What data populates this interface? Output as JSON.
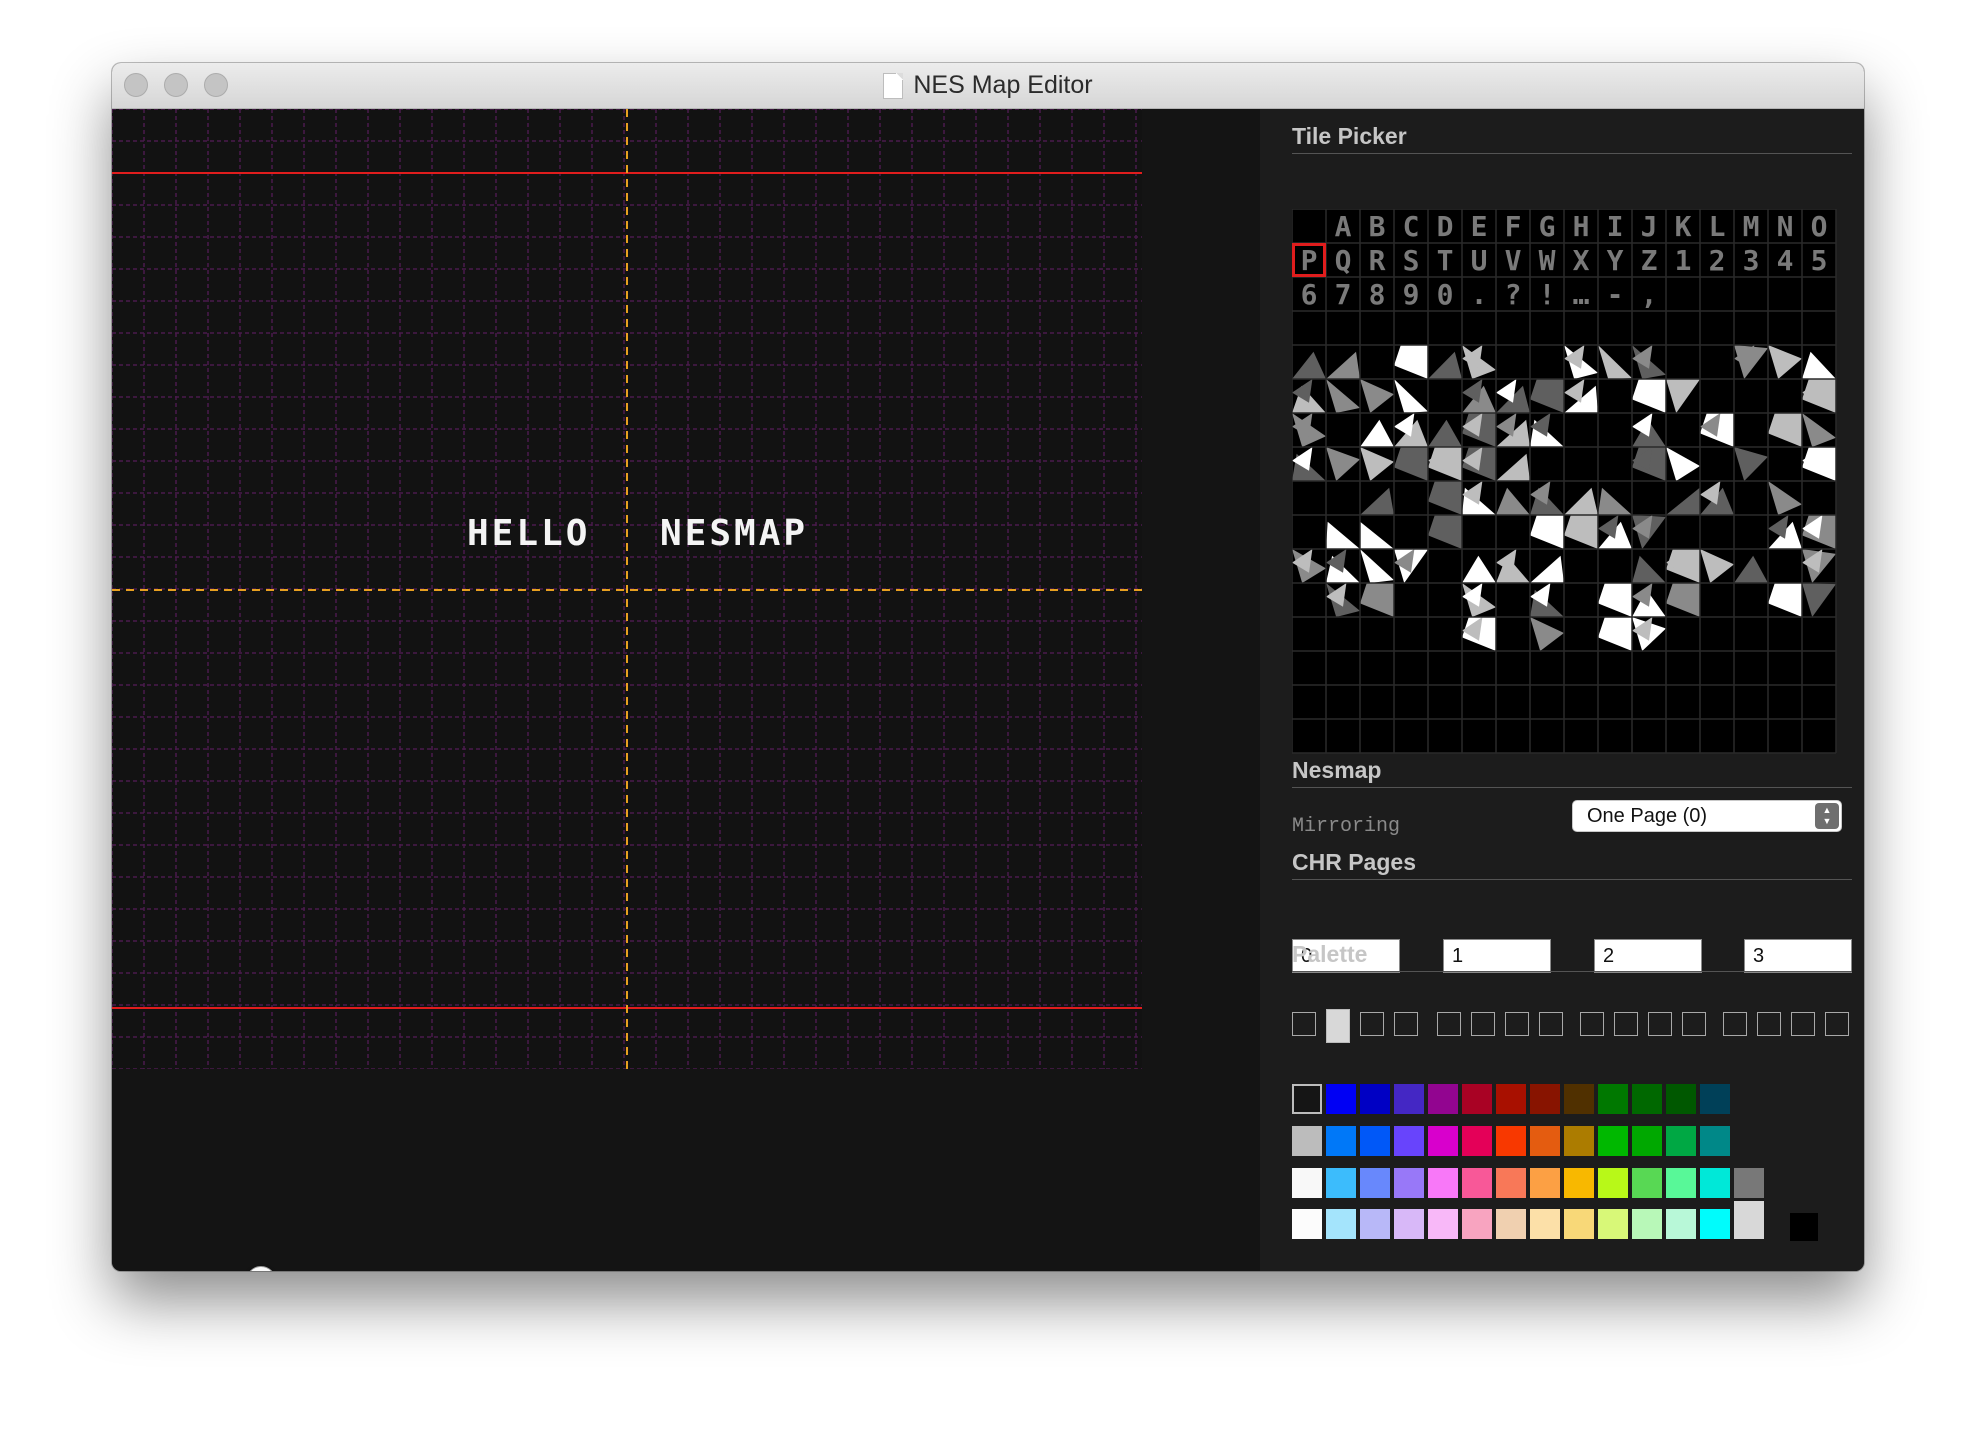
{
  "window": {
    "title": "NES Map Editor"
  },
  "map": {
    "text_words": [
      "HELLO",
      "NESMAP"
    ],
    "grid_color": "#4a1a4c",
    "boundary_color": "#e01d1d",
    "center_line_color": "#e8a020"
  },
  "zoom_slider": {
    "value": 0.12
  },
  "tile_picker": {
    "title": "Tile Picker",
    "row1": [
      "",
      "A",
      "B",
      "C",
      "D",
      "E",
      "F",
      "G",
      "H",
      "I",
      "J",
      "K",
      "L",
      "M",
      "N",
      "O"
    ],
    "row2": [
      "P",
      "Q",
      "R",
      "S",
      "T",
      "U",
      "V",
      "W",
      "X",
      "Y",
      "Z",
      "1",
      "2",
      "3",
      "4",
      "5"
    ],
    "row3": [
      "6",
      "7",
      "8",
      "9",
      "0",
      ".",
      "?",
      "!",
      "…",
      "-",
      ","
    ],
    "selected_tile": "P",
    "selected_color": "#e01d1d"
  },
  "nesmap": {
    "title": "Nesmap",
    "mirroring_label": "Mirroring",
    "mirroring_value": "One Page (0)"
  },
  "chr_pages": {
    "title": "CHR Pages",
    "values": [
      "0",
      "1",
      "2",
      "3"
    ]
  },
  "palette": {
    "title": "Palette",
    "slot_groups": 4,
    "slots_per_group": 4,
    "selected_slot": 1,
    "selected_fill": "#d8d8d8",
    "nes_colors": [
      [
        "#151515",
        "#0000f4",
        "#0000c4",
        "#4427c4",
        "#920590",
        "#a90224",
        "#a81000",
        "#881400",
        "#503000",
        "#007800",
        "#006800",
        "#005800",
        "#004058"
      ],
      [
        "#bcbcbc",
        "#0078f8",
        "#0058f8",
        "#6844fc",
        "#d800cc",
        "#e40058",
        "#f83800",
        "#e45c10",
        "#ac7c00",
        "#00b800",
        "#00a800",
        "#00a844",
        "#008888"
      ],
      [
        "#f8f8f8",
        "#3cbcfc",
        "#6888fc",
        "#9878f8",
        "#f878f8",
        "#f85898",
        "#f87858",
        "#fca044",
        "#f8b800",
        "#b8f818",
        "#58d854",
        "#58f898",
        "#00e8d8",
        "#787878"
      ],
      [
        "#fcfcfc",
        "#a4e4fc",
        "#b8b8f8",
        "#d8b8f8",
        "#f8b8f8",
        "#f8a4c0",
        "#f0d0b0",
        "#fce0a8",
        "#f8d878",
        "#d8f878",
        "#b8f8b8",
        "#b8f8d8",
        "#00fcfc",
        "#d8d8d8"
      ]
    ],
    "black_swatch": "#000000"
  }
}
